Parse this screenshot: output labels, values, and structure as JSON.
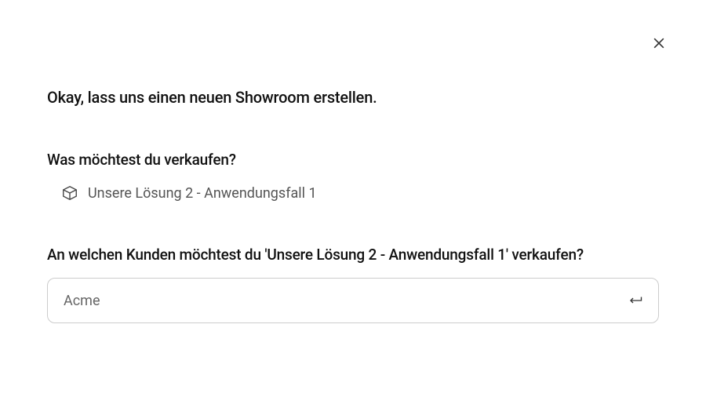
{
  "heading": "Okay, lass uns einen neuen Showroom erstellen.",
  "sell_question": "Was möchtest du verkaufen?",
  "solution": {
    "name": "Unsere Lösung 2 - Anwendungsfall 1"
  },
  "customer_question": "An welchen Kunden möchtest du 'Unsere Lösung 2 - Anwendungsfall 1' verkaufen?",
  "customer_input": {
    "value": "Acme",
    "placeholder": ""
  }
}
